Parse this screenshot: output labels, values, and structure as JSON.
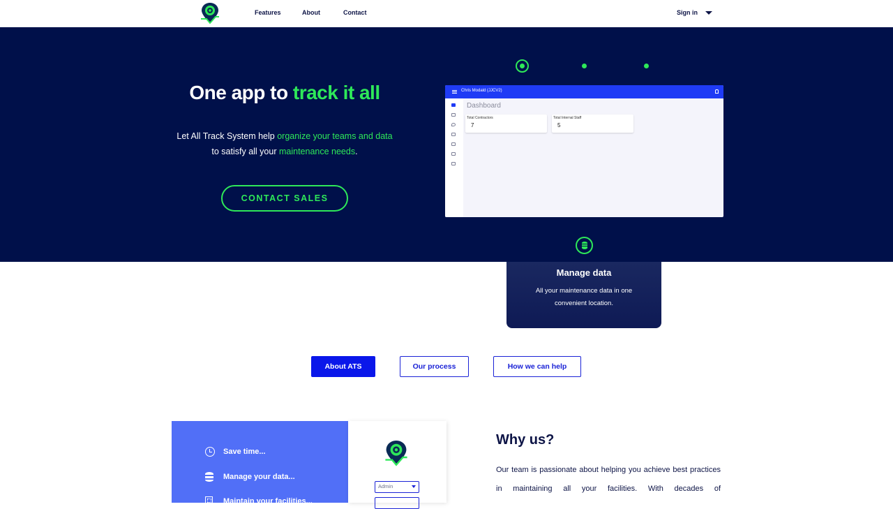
{
  "nav": {
    "features": "Features",
    "about": "About",
    "contact": "Contact",
    "signin": "Sign in"
  },
  "hero": {
    "title_plain": "One app to ",
    "title_accent": "track it all",
    "sub_1": "Let All Track System help ",
    "sub_2": "organize your teams and data",
    "sub_3": " to satisfy all your ",
    "sub_4": "maintenance needs",
    "sub_5": ".",
    "cta": "CONTACT SALES"
  },
  "mock_app": {
    "title": "Chris Modald (JJCV2)",
    "heading": "Dashboard",
    "cards": [
      {
        "label": "Total Contractors",
        "value": "7"
      },
      {
        "label": "Total Internal Staff",
        "value": "5"
      }
    ]
  },
  "feature": {
    "title": "Manage data",
    "text": "All your maintenance data in one convenient location."
  },
  "tabs": [
    {
      "label": "About ATS",
      "active": true
    },
    {
      "label": "Our process",
      "active": false
    },
    {
      "label": "How we can help",
      "active": false
    }
  ],
  "benefits": [
    {
      "icon": "clock-icon",
      "label": "Save time..."
    },
    {
      "icon": "database-icon",
      "label": "Manage your data..."
    },
    {
      "icon": "building-icon",
      "label": "Maintain your facilities..."
    }
  ],
  "login_preview": {
    "role_select": "Admin"
  },
  "why": {
    "title": "Why us?",
    "text": "Our team is passionate about helping you achieve best practices in maintaining all your facilities. With decades of"
  },
  "colors": {
    "navy": "#00104a",
    "accent_green": "#2ee859",
    "primary_blue": "#0a17ea",
    "panel_blue": "#516ff7"
  }
}
